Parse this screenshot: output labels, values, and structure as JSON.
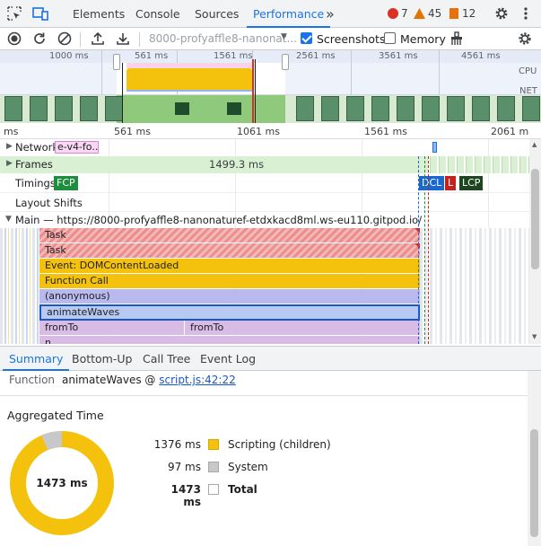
{
  "tabbar": {
    "tabs": [
      "Elements",
      "Console",
      "Sources",
      "Performance"
    ],
    "active": "Performance",
    "more": "»",
    "errors": "7",
    "warnings": "45",
    "issues": "12"
  },
  "toolbar": {
    "recording_select": "8000-profyaffle8-nanonat...",
    "screenshots_label": "Screenshots",
    "screenshots_checked": true,
    "memory_label": "Memory",
    "memory_checked": false
  },
  "overview": {
    "ticks": [
      "1000 ms",
      "561 ms",
      "1561 ms",
      "2561 ms",
      "3561 ms",
      "4561 ms"
    ],
    "cpu_label": "CPU",
    "net_label": "NET"
  },
  "ruler": {
    "ticks": [
      "ms",
      "561 ms",
      "1061 ms",
      "1561 ms",
      "2061 m"
    ]
  },
  "tracks": {
    "network_label": "Network",
    "network_request": "e-v4-fo...",
    "frames_label": "Frames",
    "frames_duration": "1499.3 ms",
    "timings_label": "Timings",
    "fcp": "FCP",
    "dcl": "DCL",
    "l": "L",
    "lcp": "LCP",
    "layout_shifts_label": "Layout Shifts",
    "main_label": "Main — https://8000-profyaffle8-nanonaturef-etdxkacd8ml.ws-eu110.gitpod.io/"
  },
  "flame": {
    "task1": "Task",
    "task2": "Task",
    "event": "Event: DOMContentLoaded",
    "function_call": "Function Call",
    "anonymous": "(anonymous)",
    "animate": "animateWaves",
    "fromto1": "fromTo",
    "fromto2": "fromTo",
    "n": "n"
  },
  "bottom_tabs": [
    "Summary",
    "Bottom-Up",
    "Call Tree",
    "Event Log"
  ],
  "summary": {
    "function_label": "Function",
    "function_name": "animateWaves @",
    "function_link": "script.js:42:22",
    "aggregated_title": "Aggregated Time",
    "total_center": "1473 ms",
    "rows": [
      {
        "value": "1376 ms",
        "label": "Scripting (children)",
        "color": "#f4c20d"
      },
      {
        "value": "97 ms",
        "label": "System",
        "color": "#c8c8c8"
      },
      {
        "value": "1473 ms",
        "label": "Total",
        "color": "#ffffff"
      }
    ]
  },
  "colors": {
    "accent": "#1a73e8",
    "scripting": "#f4c20d",
    "system": "#c8c8c8",
    "task_red": "#e57373",
    "fcp_green": "#1e8e3e",
    "dcl_blue": "#1967d2",
    "l_red": "#c5221f",
    "lcp_dark": "#1e4620"
  }
}
